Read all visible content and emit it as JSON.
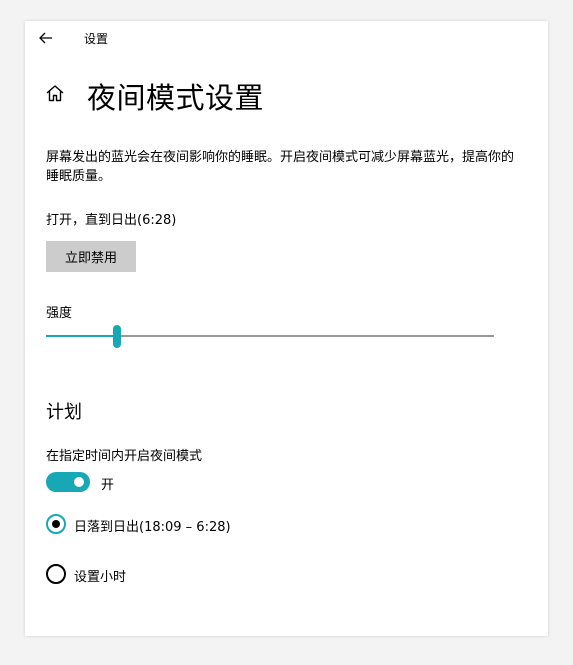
{
  "titlebar": {
    "app_title": "设置",
    "back_icon": "back-arrow-icon"
  },
  "header": {
    "home_icon": "home-icon",
    "title": "夜间模式设置"
  },
  "description": "屏幕发出的蓝光会在夜间影响你的睡眠。开启夜间模式可减少屏幕蓝光，提高你的睡眠质量。",
  "status_text": "打开，直到日出(6:28)",
  "disable_button_label": "立即禁用",
  "strength": {
    "label": "强度",
    "value_fraction": 0.158
  },
  "schedule": {
    "section_title": "计划",
    "toggle_label": "在指定时间内开启夜间模式",
    "toggle_state_text": "开",
    "toggle_on": true,
    "options": [
      {
        "label": "日落到日出(18:09 – 6:28)",
        "checked": true
      },
      {
        "label": "设置小时",
        "checked": false
      }
    ]
  },
  "colors": {
    "accent": "#18a7b5",
    "button_bg": "#cccccc",
    "track_rest": "#999999"
  }
}
